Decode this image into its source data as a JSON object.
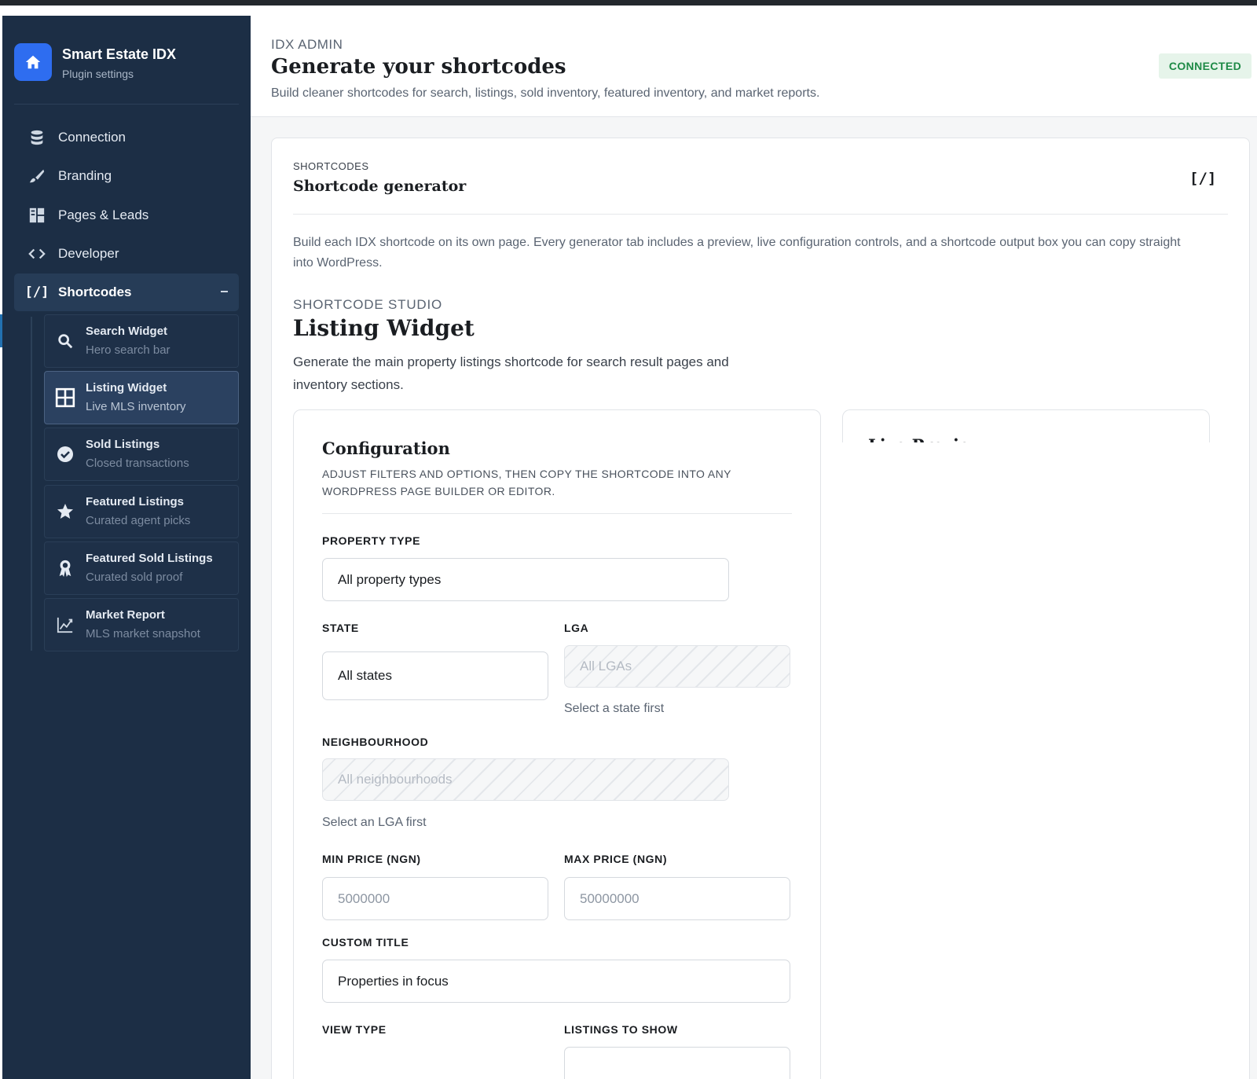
{
  "sidebar": {
    "brand_title": "Smart Estate IDX",
    "brand_subtitle": "Plugin settings",
    "nav": [
      {
        "label": "Connection",
        "icon": "database-icon"
      },
      {
        "label": "Branding",
        "icon": "brush-icon"
      },
      {
        "label": "Pages & Leads",
        "icon": "pages-icon"
      },
      {
        "label": "Developer",
        "icon": "code-icon"
      },
      {
        "label": "Shortcodes",
        "icon": "shortcode-icon",
        "active": true,
        "expanded": true
      }
    ],
    "subitems": [
      {
        "title": "Search Widget",
        "desc": "Hero search bar",
        "icon": "search-icon"
      },
      {
        "title": "Listing Widget",
        "desc": "Live MLS inventory",
        "icon": "grid-icon",
        "active": true
      },
      {
        "title": "Sold Listings",
        "desc": "Closed transactions",
        "icon": "check-circle-icon"
      },
      {
        "title": "Featured Listings",
        "desc": "Curated agent picks",
        "icon": "star-icon"
      },
      {
        "title": "Featured Sold Listings",
        "desc": "Curated sold proof",
        "icon": "award-icon"
      },
      {
        "title": "Market Report",
        "desc": "MLS market snapshot",
        "icon": "chart-icon"
      }
    ]
  },
  "header": {
    "eyebrow": "IDX ADMIN",
    "title": "Generate your shortcodes",
    "subtitle": "Build cleaner shortcodes for search, listings, sold inventory, featured inventory, and market reports.",
    "status": "CONNECTED"
  },
  "card": {
    "eyebrow": "SHORTCODES",
    "title": "Shortcode generator",
    "icon_text": "[/]",
    "description": "Build each IDX shortcode on its own page. Every generator tab includes a preview, live configuration controls, and a shortcode output box you can copy straight into WordPress."
  },
  "studio": {
    "eyebrow": "SHORTCODE STUDIO",
    "title": "Listing Widget",
    "description": "Generate the main property listings shortcode for search result pages and inventory sections."
  },
  "config": {
    "title": "Configuration",
    "subtitle": "Adjust filters and options, then copy the shortcode into any WordPress page builder or editor.",
    "property_type": {
      "label": "PROPERTY TYPE",
      "value": "All property types"
    },
    "state": {
      "label": "STATE",
      "value": "All states"
    },
    "lga": {
      "label": "LGA",
      "value": "All LGAs",
      "helper": "Select a state first"
    },
    "neighbourhood": {
      "label": "NEIGHBOURHOOD",
      "value": "All neighbourhoods",
      "helper": "Select an LGA first"
    },
    "min_price": {
      "label": "MIN PRICE (NGN)",
      "placeholder": "5000000"
    },
    "max_price": {
      "label": "MAX PRICE (NGN)",
      "placeholder": "50000000"
    },
    "custom_title": {
      "label": "CUSTOM TITLE",
      "value": "Properties in focus"
    },
    "view_type": {
      "label": "VIEW TYPE"
    },
    "listings_to_show": {
      "label": "LISTINGS TO SHOW"
    }
  },
  "preview": {
    "title": "Live Preview"
  },
  "colors": {
    "sidebar_bg": "#1c2e45",
    "accent": "#2e6df0",
    "status_green": "#1e8a46"
  }
}
